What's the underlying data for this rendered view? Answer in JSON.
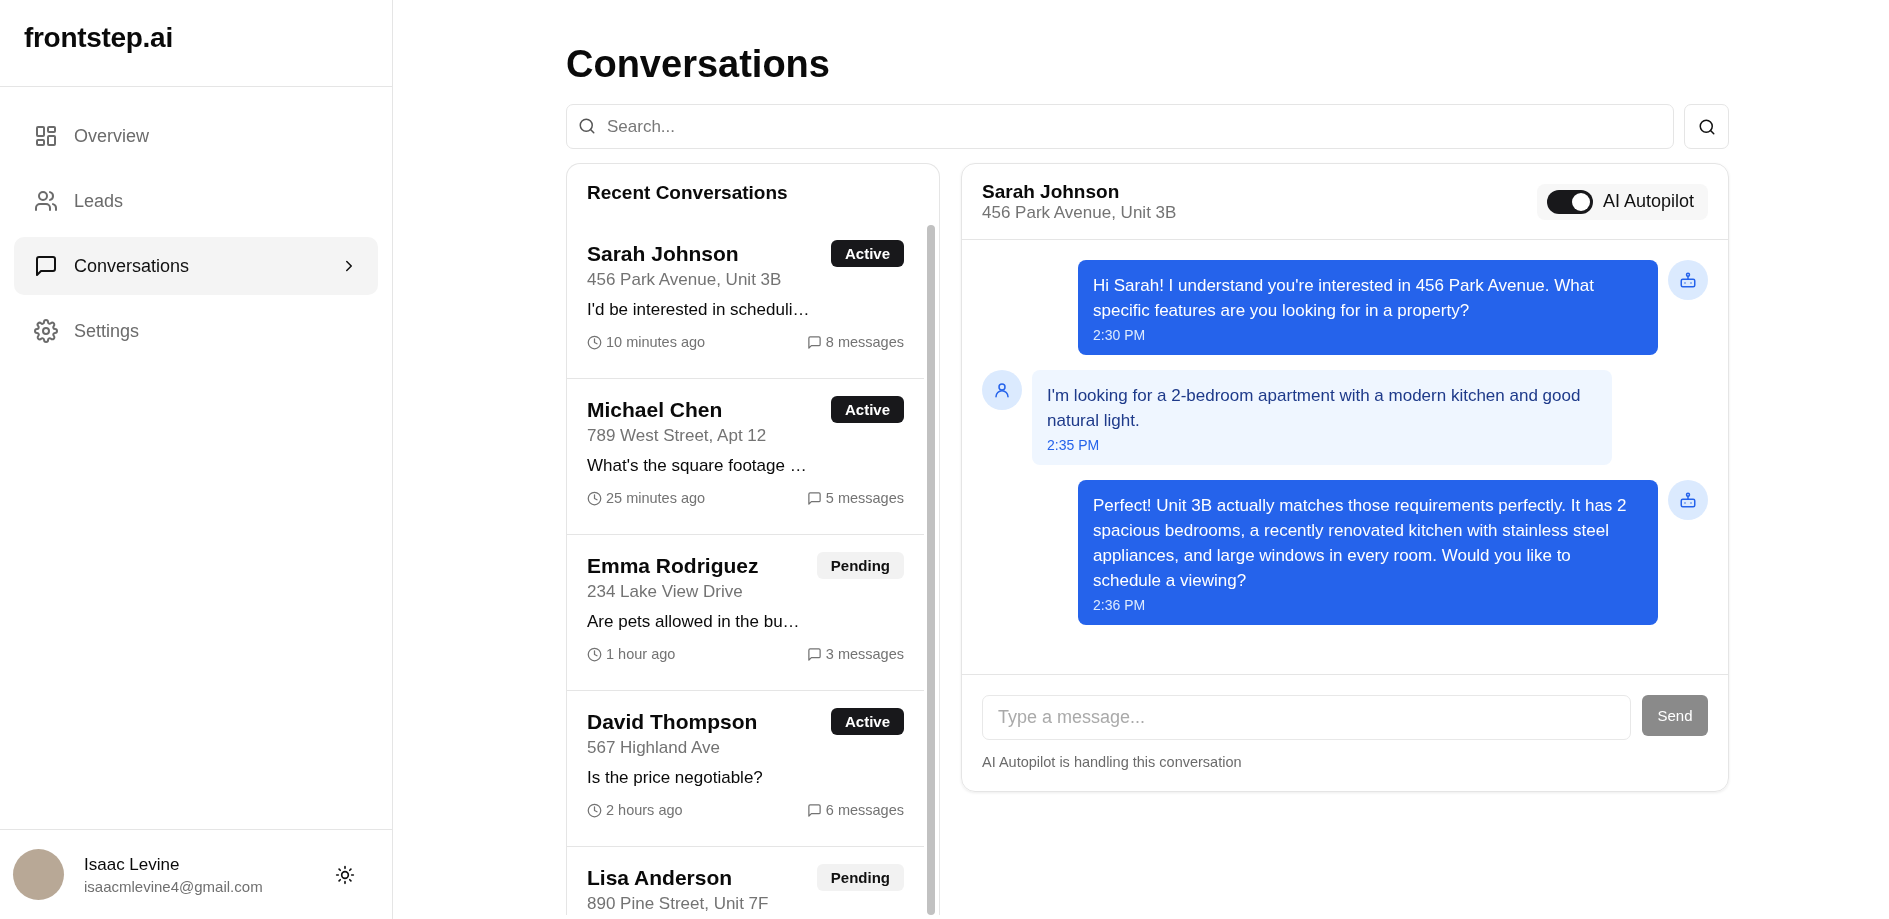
{
  "sidebar": {
    "logo": "frontstep.ai",
    "items": [
      {
        "label": "Overview",
        "kind": "grid",
        "selected": false
      },
      {
        "label": "Leads",
        "kind": "users",
        "selected": false
      },
      {
        "label": "Conversations",
        "kind": "chat",
        "selected": true
      },
      {
        "label": "Settings",
        "kind": "gear",
        "selected": false
      }
    ],
    "user": {
      "name": "Isaac Levine",
      "email": "isaacmlevine4@gmail.com"
    }
  },
  "page_title": "Conversations",
  "search": {
    "placeholder": "Search..."
  },
  "conversation_list": {
    "title": "Recent Conversations",
    "items": [
      {
        "name": "Sarah Johnson",
        "address": "456 Park Avenue, Unit 3B",
        "preview": "I'd be interested in scheduli…",
        "time": "10 minutes ago",
        "messages": "8 messages",
        "status": "Active",
        "kind": "active"
      },
      {
        "name": "Michael Chen",
        "address": "789 West Street, Apt 12",
        "preview": "What's the square footage …",
        "time": "25 minutes ago",
        "messages": "5 messages",
        "status": "Active",
        "kind": "active"
      },
      {
        "name": "Emma Rodriguez",
        "address": "234 Lake View Drive",
        "preview": "Are pets allowed in the bu…",
        "time": "1 hour ago",
        "messages": "3 messages",
        "status": "Pending",
        "kind": "pending"
      },
      {
        "name": "David Thompson",
        "address": "567 Highland Ave",
        "preview": "Is the price negotiable?",
        "time": "2 hours ago",
        "messages": "6 messages",
        "status": "Active",
        "kind": "active"
      },
      {
        "name": "Lisa Anderson",
        "address": "890 Pine Street, Unit 7F",
        "status": "Pending",
        "kind": "pending"
      }
    ]
  },
  "chat": {
    "name": "Sarah Johnson",
    "address": "456 Park Avenue, Unit 3B",
    "autopilot": {
      "label": "AI Autopilot",
      "on": true
    },
    "messages": [
      {
        "kind": "ai",
        "text": "Hi Sarah! I understand you're interested in 456 Park Avenue. What specific features are you looking for in a property?",
        "time": "2:30 PM"
      },
      {
        "kind": "user",
        "text": "I'm looking for a 2-bedroom apartment with a modern kitchen and good natural light.",
        "time": "2:35 PM"
      },
      {
        "kind": "ai",
        "text": "Perfect! Unit 3B actually matches those requirements perfectly. It has 2 spacious bedrooms, a recently renovated kitchen with stainless steel appliances, and large windows in every room. Would you like to schedule a viewing?",
        "time": "2:36 PM"
      }
    ],
    "input": {
      "placeholder": "Type a message..."
    },
    "send_button": "Send",
    "footer_note": "AI Autopilot is handling this conversation"
  }
}
